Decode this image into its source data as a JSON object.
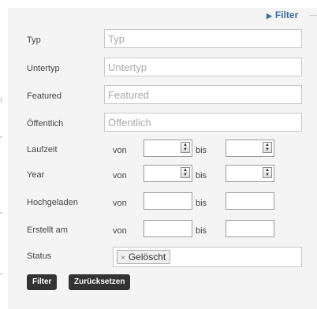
{
  "legend": {
    "label": "Filter"
  },
  "fields": [
    {
      "label": "Typ",
      "placeholder": "Typ",
      "value": ""
    },
    {
      "label": "Untertyp",
      "placeholder": "Untertyp",
      "value": ""
    },
    {
      "label": "Featured",
      "placeholder": "Featured",
      "value": ""
    },
    {
      "label": "Öffentlich",
      "placeholder": "Öffentlich",
      "value": ""
    }
  ],
  "ranges": [
    {
      "label": "Laufzeit",
      "from_label": "von",
      "to_label": "bis",
      "from_value": "",
      "to_value": "",
      "type": "number"
    },
    {
      "label": "Year",
      "from_label": "von",
      "to_label": "bis",
      "from_value": "",
      "to_value": "",
      "type": "number"
    },
    {
      "label": "Hochgeladen",
      "from_label": "von",
      "to_label": "bis",
      "from_value": "",
      "to_value": "",
      "type": "text"
    },
    {
      "label": "Erstellt am",
      "from_label": "von",
      "to_label": "bis",
      "from_value": "",
      "to_value": "",
      "type": "text"
    }
  ],
  "status": {
    "label": "Status",
    "selected": [
      "Gelöscht"
    ],
    "remove_glyph": "×"
  },
  "buttons": {
    "filter": "Filter",
    "reset": "Zurücksetzen"
  },
  "colors": {
    "accent": "#3a6ea5",
    "button_bg": "#333333",
    "panel_bg": "#f4f4f4"
  },
  "icons": {
    "legend": "triangle-right-icon",
    "spinner": "spinner-arrows-icon",
    "remove": "remove-x-icon"
  }
}
